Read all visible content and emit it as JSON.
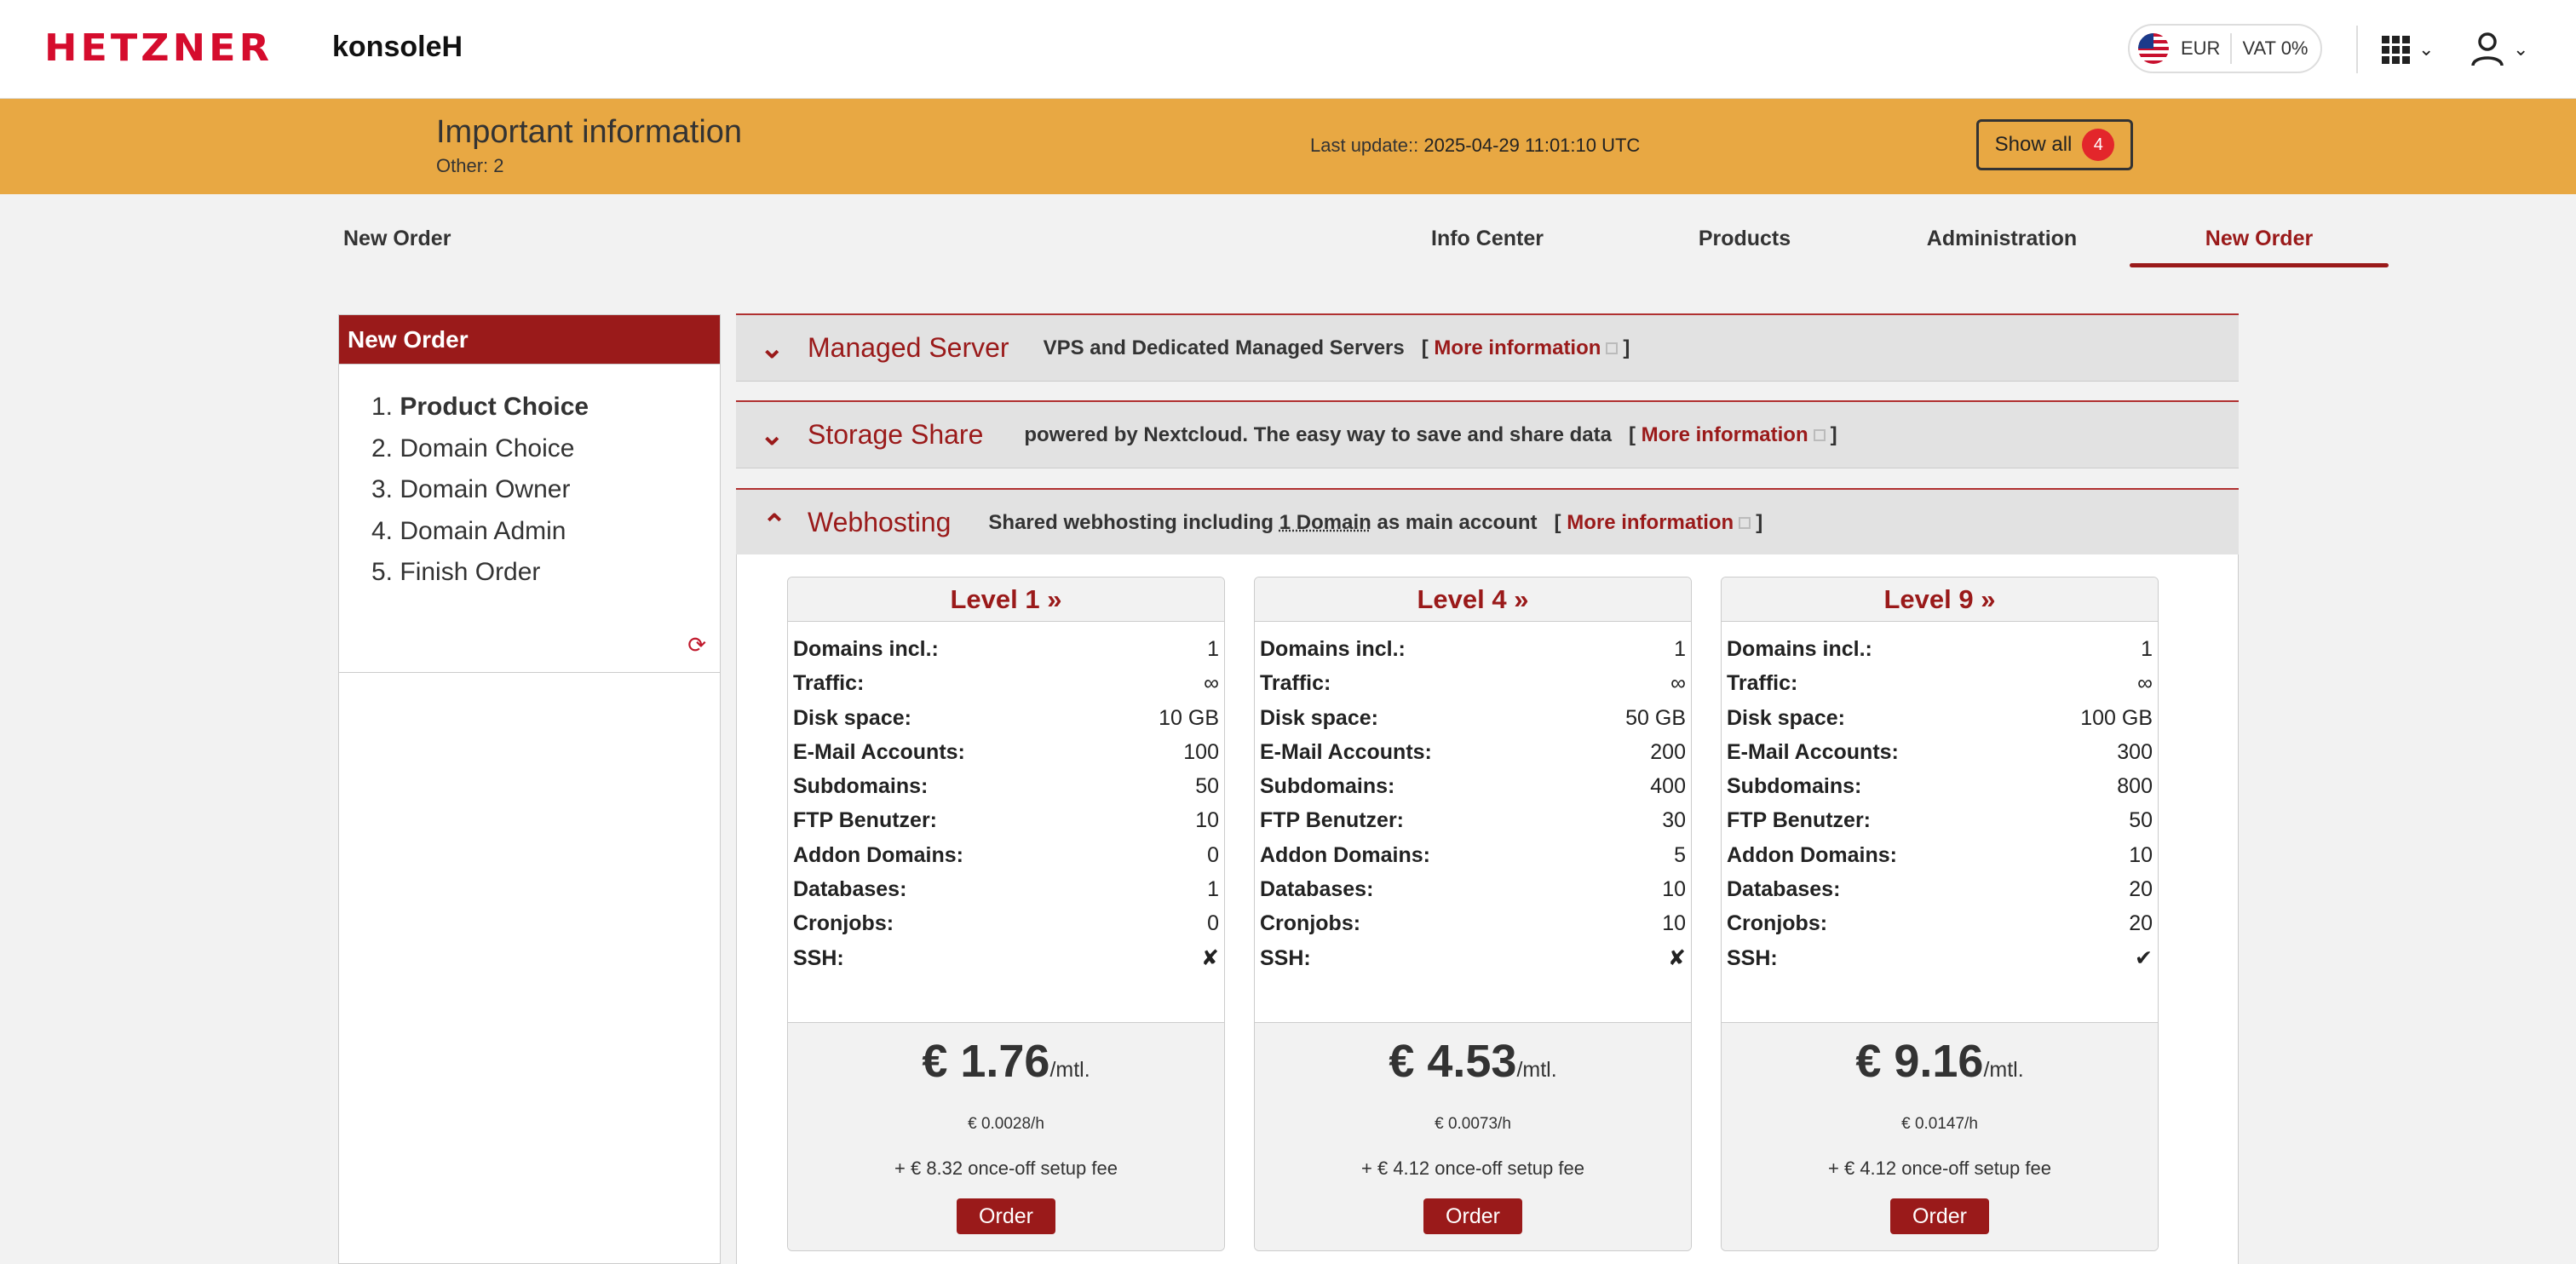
{
  "header": {
    "logo": "HETZNER",
    "app_name": "konsoleH",
    "currency": "EUR",
    "vat": "VAT 0%"
  },
  "banner": {
    "title": "Important information",
    "other_label": "Other:",
    "other_count": "2",
    "last_update_label": "Last update::",
    "last_update_value": "2025-04-29 11:01:10 UTC",
    "show_all_label": "Show all",
    "show_all_count": "4"
  },
  "nav": {
    "page_title": "New Order",
    "items": [
      {
        "label": "Info Center"
      },
      {
        "label": "Products"
      },
      {
        "label": "Administration"
      },
      {
        "label": "New Order",
        "active": true
      }
    ]
  },
  "sidebar": {
    "title": "New Order",
    "steps": [
      {
        "num": "1.",
        "label": "Product Choice",
        "active": true
      },
      {
        "num": "2.",
        "label": "Domain Choice"
      },
      {
        "num": "3.",
        "label": "Domain Owner"
      },
      {
        "num": "4.",
        "label": "Domain Admin"
      },
      {
        "num": "5.",
        "label": "Finish Order"
      }
    ]
  },
  "sections": [
    {
      "title": "Managed Server",
      "description": "VPS and Dedicated Managed Servers",
      "more": "More information",
      "expanded": false
    },
    {
      "title": "Storage Share",
      "description": "powered by Nextcloud. The easy way to save and share data",
      "more": "More information",
      "expanded": false
    },
    {
      "title": "Webhosting",
      "description_pre": "Shared webhosting including",
      "description_link": "1 Domain",
      "description_post": "as main account",
      "more": "More information",
      "expanded": true
    }
  ],
  "bracket_open": "[",
  "bracket_close": "]",
  "plans": [
    {
      "name": "Level 1 »",
      "rows": [
        {
          "k": "Domains incl.:",
          "v": "1"
        },
        {
          "k": "Traffic:",
          "v": "∞"
        },
        {
          "k": "Disk space:",
          "v": "10 GB"
        },
        {
          "k": "E-Mail Accounts:",
          "v": "100"
        },
        {
          "k": "Subdomains:",
          "v": "50"
        },
        {
          "k": "FTP Benutzer:",
          "v": "10"
        },
        {
          "k": "Addon Domains:",
          "v": "0"
        },
        {
          "k": "Databases:",
          "v": "1"
        },
        {
          "k": "Cronjobs:",
          "v": "0"
        },
        {
          "k": "SSH:",
          "v": "✘"
        }
      ],
      "price": "€ 1.76",
      "unit": "/mtl.",
      "hourly": "€ 0.0028/h",
      "setup": "+ € 8.32 once-off setup fee",
      "order": "Order"
    },
    {
      "name": "Level 4 »",
      "rows": [
        {
          "k": "Domains incl.:",
          "v": "1"
        },
        {
          "k": "Traffic:",
          "v": "∞"
        },
        {
          "k": "Disk space:",
          "v": "50 GB"
        },
        {
          "k": "E-Mail Accounts:",
          "v": "200"
        },
        {
          "k": "Subdomains:",
          "v": "400"
        },
        {
          "k": "FTP Benutzer:",
          "v": "30"
        },
        {
          "k": "Addon Domains:",
          "v": "5"
        },
        {
          "k": "Databases:",
          "v": "10"
        },
        {
          "k": "Cronjobs:",
          "v": "10"
        },
        {
          "k": "SSH:",
          "v": "✘"
        }
      ],
      "price": "€ 4.53",
      "unit": "/mtl.",
      "hourly": "€ 0.0073/h",
      "setup": "+ € 4.12 once-off setup fee",
      "order": "Order"
    },
    {
      "name": "Level 9 »",
      "rows": [
        {
          "k": "Domains incl.:",
          "v": "1"
        },
        {
          "k": "Traffic:",
          "v": "∞"
        },
        {
          "k": "Disk space:",
          "v": "100 GB"
        },
        {
          "k": "E-Mail Accounts:",
          "v": "300"
        },
        {
          "k": "Subdomains:",
          "v": "800"
        },
        {
          "k": "FTP Benutzer:",
          "v": "50"
        },
        {
          "k": "Addon Domains:",
          "v": "10"
        },
        {
          "k": "Databases:",
          "v": "20"
        },
        {
          "k": "Cronjobs:",
          "v": "20"
        },
        {
          "k": "SSH:",
          "v": "✔"
        }
      ],
      "price": "€ 9.16",
      "unit": "/mtl.",
      "hourly": "€ 0.0147/h",
      "setup": "+ € 4.12 once-off setup fee",
      "order": "Order"
    }
  ],
  "colors": {
    "brand_red": "#d50c2d",
    "accent_dark_red": "#9a1a1a",
    "banner_orange": "#e8a843",
    "badge_red": "#e3262b"
  },
  "icons": [
    "us-flag-icon",
    "apps-grid-icon",
    "chevron-down-icon",
    "user-icon",
    "refresh-icon",
    "external-link-icon",
    "chevron-up-icon"
  ]
}
